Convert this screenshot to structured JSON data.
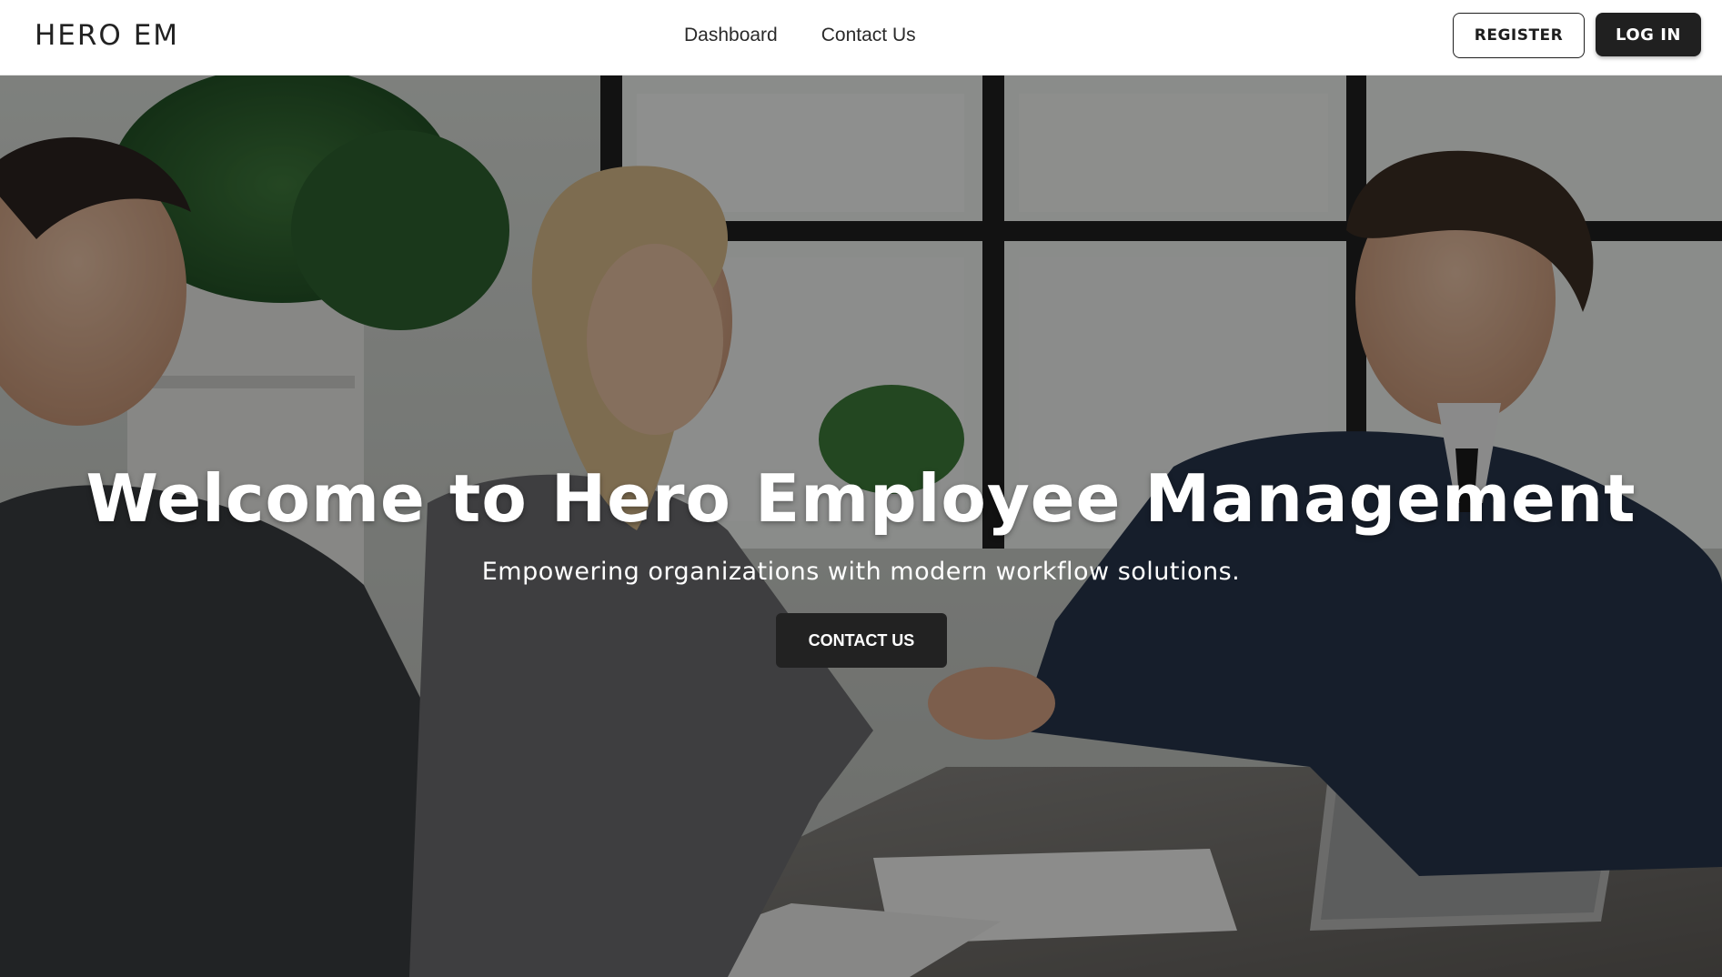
{
  "header": {
    "logo_text": "HERO EM",
    "nav": [
      {
        "label": "Dashboard"
      },
      {
        "label": "Contact Us"
      }
    ],
    "register_label": "REGISTER",
    "login_label": "LOG IN"
  },
  "hero": {
    "title": "Welcome to Hero Employee Management",
    "subtitle": "Empowering organizations with modern workflow solutions.",
    "cta_label": "CONTACT US"
  }
}
